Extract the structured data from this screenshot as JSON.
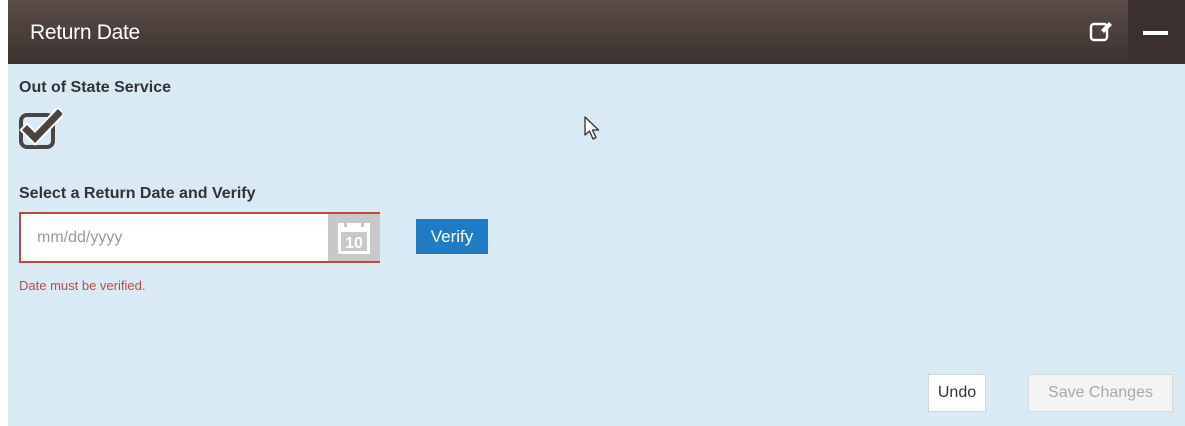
{
  "header": {
    "title": "Return Date",
    "edit_icon": "edit-icon",
    "collapse_icon": "minus-icon"
  },
  "out_of_state": {
    "label": "Out of State Service",
    "checked": true,
    "icon": "checkbox-checked-icon"
  },
  "return_date": {
    "label": "Select a Return Date and Verify",
    "value": "",
    "placeholder": "mm/dd/yyyy",
    "calendar_icon": "calendar-icon",
    "calendar_day": "10",
    "verify_label": "Verify",
    "error": "Date must be verified."
  },
  "actions": {
    "undo_label": "Undo",
    "save_label": "Save Changes",
    "save_disabled": true
  },
  "colors": {
    "header_bg": "#4a3e3a",
    "panel_bg": "#d9eaf5",
    "primary": "#1f7bc4",
    "error": "#b94a48"
  }
}
